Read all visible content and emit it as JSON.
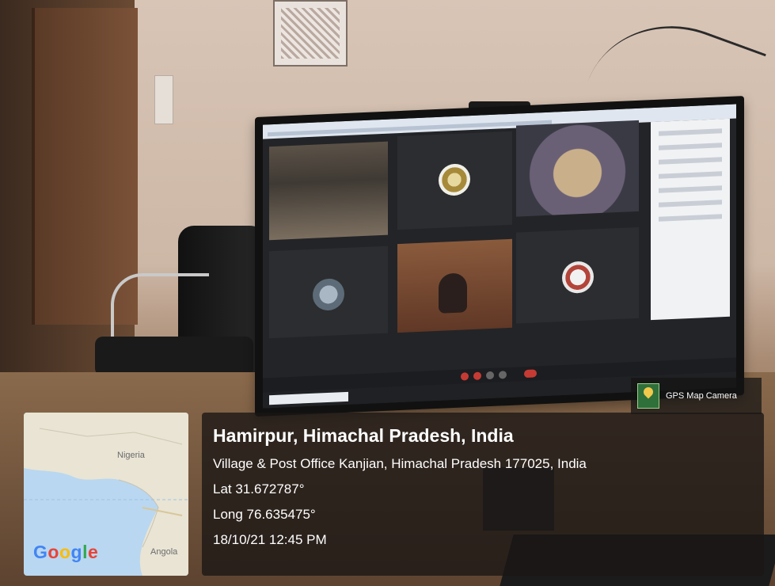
{
  "overlay": {
    "app_badge": "GPS Map Camera",
    "place_title": "Hamirpur, Himachal Pradesh, India",
    "address": "Village & Post Office Kanjian, Himachal Pradesh 177025, India",
    "latitude": "Lat 31.672787°",
    "longitude": "Long 76.635475°",
    "datetime": "18/10/21 12:45 PM"
  },
  "map": {
    "labels": [
      "Nigeria",
      "Angola"
    ],
    "brand": [
      "G",
      "o",
      "o",
      "g",
      "l",
      "e"
    ],
    "brand_colors": [
      "#4285F4",
      "#EA4335",
      "#FBBC05",
      "#4285F4",
      "#34A853",
      "#EA4335"
    ]
  }
}
